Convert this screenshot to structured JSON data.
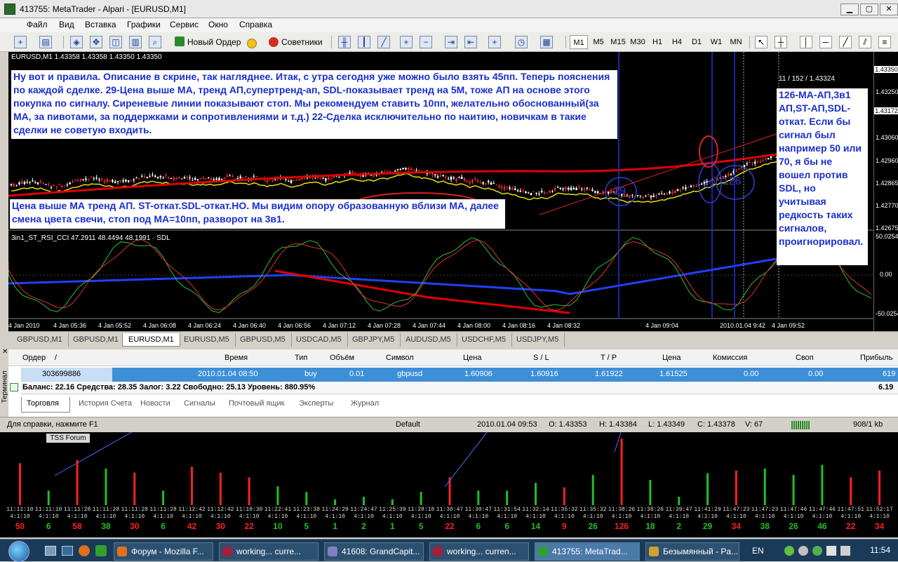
{
  "window": {
    "title": "413755: MetaTrader - Alpari - [EURUSD,M1]",
    "min": "▁",
    "max": "▢",
    "close": "✕"
  },
  "menu": [
    "Файл",
    "Вид",
    "Вставка",
    "Графики",
    "Сервис",
    "Окно",
    "Справка"
  ],
  "toolbar": {
    "new_order": "Новый Ордер",
    "experts": "Советники",
    "timeframes": [
      "M1",
      "M5",
      "M15",
      "M30",
      "H1",
      "H4",
      "D1",
      "W1",
      "MN"
    ]
  },
  "chart": {
    "header": "EURUSD,M1  1.43358 1.43358 1.43350 1.43350",
    "indicator_header": "3in1_ST_RSI_CCI 47.2911 48.4494 48.1991 · SDL",
    "info_label": "11 / 152 / 1.43324",
    "price_labels": [
      "1.43350",
      "1.43250",
      "1.43172",
      "1.43060",
      "1.42960",
      "1.42865",
      "1.42770",
      "1.42675"
    ],
    "indicator_labels": [
      "50.0254",
      "0.00",
      "-50.0254"
    ],
    "time_labels": [
      "4 Jan 2010",
      "4 Jan 05:36",
      "4 Jan 05:52",
      "4 Jan 06:08",
      "4 Jan 06:24",
      "4 Jan 06:40",
      "4 Jan 06:56",
      "4 Jan 07:12",
      "4 Jan 07:28",
      "4 Jan 07:44",
      "4 Jan 08:00",
      "4 Jan 08:16",
      "4 Jan 08:32",
      "4 Jan 09:04",
      "2010.01.04 9:42",
      "4 Jan 09:52"
    ],
    "annotation_top": "Ну вот и правила. Описание в скрине, так нагляднее. Итак, с утра сегодня уже можно было взять 45пп. Теперь пояснения по каждой сделке. 29-Цена выше МА, тренд АП,супертренд-ап, SDL-показывает тренд на 5М, тоже АП на основе этого покупка по сигналу. Сиреневые линии показывают стоп. Мы рекомендуем ставить 10пп, желательно обоснованный(за МА, за пивотами, за поддержками и сопротивлениями и т.д.) 22-Сделка исключительно по наитию, новичкам в такие сделки не советую входить.",
    "annotation_mid": "Цена выше МА тренд АП. ST-откат.SDL-откат.НО. Мы видим опору образованную вблизи МА, далее смена цвета свечи, стоп под МА=10пп, разворот на 3в1.",
    "annotation_right": "126-МА-АП,3в1 АП,ST-АП,SDL-откат. Если бы сигнал был например 50 или 70, я бы не вошел против SDL, но учитывая редкость таких сигналов, проигнорировал.",
    "circle_labels": [
      "29",
      "22",
      "126"
    ]
  },
  "chart_tabs": [
    "GBPUSD,M1",
    "GBPUSD,M1",
    "EURUSD,M1",
    "EURUSD,M5",
    "GBPUSD,M5",
    "USDCAD,M5",
    "GBPJPY,M5",
    "AUDUSD,M5",
    "USDCHF,M5",
    "USDJPY,M5"
  ],
  "active_chart_tab": "EURUSD,M1",
  "terminal": {
    "side_label": "Терминал",
    "close_icon": "✕",
    "columns": [
      "Ордер",
      "/",
      "Время",
      "Тип",
      "Объём",
      "Символ",
      "Цена",
      "S / L",
      "T / P",
      "Цена",
      "Комиссия",
      "Своп",
      "Прибыль"
    ],
    "order": {
      "id": "303699886",
      "time": "2010.01.04 08:50",
      "type": "buy",
      "volume": "0.01",
      "symbol": "gbpusd",
      "price": "1.60906",
      "sl": "1.60916",
      "tp": "1.61922",
      "cur_price": "1.61525",
      "commission": "0.00",
      "swap": "0.00",
      "profit": "619"
    },
    "balance": "Баланс: 22.16  Средства: 28.35  Залог: 3.22  Свободно: 25.13  Уровень: 880.95%",
    "balance_profit": "6.19",
    "tabs": [
      "Торговля",
      "История Счета",
      "Новости",
      "Сигналы",
      "Почтовый ящик",
      "Эксперты",
      "Журнал"
    ]
  },
  "status": {
    "help": "Для справки, нажмите F1",
    "profile": "Default",
    "datetime": "2010.01.04 09:53",
    "open": "O: 1.43353",
    "high": "H: 1.43384",
    "low": "L: 1.43349",
    "close": "C: 1.43378",
    "volume": "V: 67",
    "traffic": "908/1 kb"
  },
  "histogram": {
    "label": "TSS Forum",
    "times": [
      "11:11:10",
      "11:11:10",
      "11:11:28",
      "11:11:28",
      "11:11:28",
      "11:11:28",
      "11:12:42",
      "11:12:42",
      "11:19:30",
      "11:22:41",
      "11:23:38",
      "11:24:29",
      "11:24:47",
      "11:25:39",
      "11:28:18",
      "11:30:47",
      "11:30:47",
      "11:31:54",
      "11:32:14",
      "11:35:32",
      "11:35:32",
      "11:38:26",
      "11:38:26",
      "11:39:47",
      "11:41:29",
      "11:47:23",
      "11:47:23",
      "11:47:46",
      "11:47:46",
      "11:47:51",
      "11:52:17"
    ],
    "ratio": "4:1:10",
    "values": [
      50,
      6,
      58,
      38,
      30,
      6,
      42,
      30,
      22,
      10,
      5,
      1,
      2,
      1,
      5,
      22,
      6,
      6,
      14,
      9,
      26,
      126,
      18,
      2,
      29,
      34,
      38,
      26,
      46,
      22,
      34
    ],
    "colors": [
      "#ff2020",
      "#20c020"
    ]
  },
  "taskbar": {
    "items": [
      "Форум - Mozilla F...",
      "working...  curre...",
      "41608: GrandCapit...",
      "working...  curren...",
      "413755: MetaTrad...",
      "Безымянный - Pa..."
    ],
    "lang": "EN",
    "clock": "11:54"
  }
}
